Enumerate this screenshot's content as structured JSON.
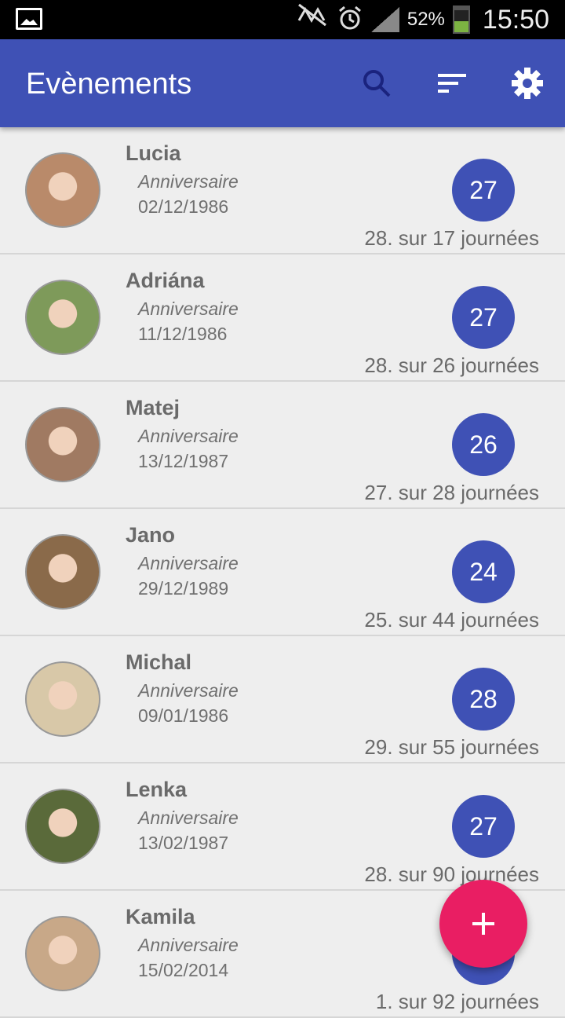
{
  "status_bar": {
    "battery_percent": "52%",
    "time": "15:50"
  },
  "app_bar": {
    "title": "Evènements"
  },
  "events": [
    {
      "name": "Lucia",
      "type": "Anniversaire",
      "date": "02/12/1986",
      "badge": "27",
      "countdown": "28. sur 17 journées",
      "avatar_color": "#b98a6a"
    },
    {
      "name": "Adriána",
      "type": "Anniversaire",
      "date": "11/12/1986",
      "badge": "27",
      "countdown": "28. sur 26 journées",
      "avatar_color": "#7e9a5a"
    },
    {
      "name": "Matej",
      "type": "Anniversaire",
      "date": "13/12/1987",
      "badge": "26",
      "countdown": "27. sur 28 journées",
      "avatar_color": "#a07a62"
    },
    {
      "name": "Jano",
      "type": "Anniversaire",
      "date": "29/12/1989",
      "badge": "24",
      "countdown": "25. sur 44 journées",
      "avatar_color": "#8a6a4a"
    },
    {
      "name": "Michal",
      "type": "Anniversaire",
      "date": "09/01/1986",
      "badge": "28",
      "countdown": "29. sur 55 journées",
      "avatar_color": "#d8c8a8"
    },
    {
      "name": "Lenka",
      "type": "Anniversaire",
      "date": "13/02/1987",
      "badge": "27",
      "countdown": "28. sur 90 journées",
      "avatar_color": "#5a6a3a"
    },
    {
      "name": "Kamila",
      "type": "Anniversaire",
      "date": "15/02/2014",
      "badge": "",
      "countdown": "1. sur 92 journées",
      "avatar_color": "#c8a888"
    }
  ],
  "fab": {
    "icon": "plus-icon",
    "color": "#e91e63"
  }
}
